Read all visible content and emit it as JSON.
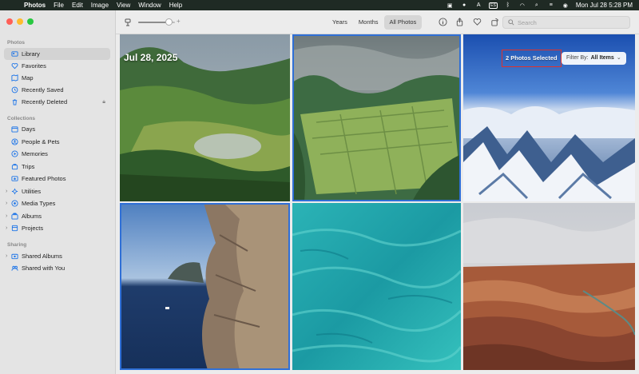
{
  "menubar": {
    "app_name": "Photos",
    "menus": [
      "File",
      "Edit",
      "Image",
      "View",
      "Window",
      "Help"
    ],
    "input_source": "ES",
    "datetime": "Mon Jul 28  5:28 PM"
  },
  "sidebar": {
    "sections": {
      "photos": "Photos",
      "collections": "Collections",
      "sharing": "Sharing"
    },
    "photos_items": [
      {
        "label": "Library",
        "icon": "library-icon",
        "selected": true
      },
      {
        "label": "Favorites",
        "icon": "heart-icon"
      },
      {
        "label": "Map",
        "icon": "map-icon"
      },
      {
        "label": "Recently Saved",
        "icon": "recently-saved-icon"
      },
      {
        "label": "Recently Deleted",
        "icon": "trash-icon",
        "locked": true
      }
    ],
    "collections_items": [
      {
        "label": "Days",
        "icon": "calendar-icon"
      },
      {
        "label": "People & Pets",
        "icon": "person-icon"
      },
      {
        "label": "Memories",
        "icon": "memories-icon"
      },
      {
        "label": "Trips",
        "icon": "suitcase-icon"
      },
      {
        "label": "Featured Photos",
        "icon": "featured-icon"
      },
      {
        "label": "Utilities",
        "icon": "utilities-icon",
        "expandable": true
      },
      {
        "label": "Media Types",
        "icon": "media-types-icon",
        "expandable": true
      },
      {
        "label": "Albums",
        "icon": "albums-icon",
        "expandable": true
      },
      {
        "label": "Projects",
        "icon": "projects-icon",
        "expandable": true
      }
    ],
    "sharing_items": [
      {
        "label": "Shared Albums",
        "icon": "shared-albums-icon",
        "expandable": true
      },
      {
        "label": "Shared with You",
        "icon": "shared-with-you-icon"
      }
    ]
  },
  "toolbar": {
    "views": [
      "Years",
      "Months",
      "All Photos"
    ],
    "active_view": "All Photos",
    "search_placeholder": "Search",
    "zoom_level": 0.8
  },
  "grid": {
    "date_heading": "Jul 28, 2025",
    "selected_count": "2 Photos Selected",
    "filter_label": "Filter By:",
    "filter_value": "All Items"
  },
  "colors": {
    "accent": "#1a73e8",
    "selection_outline": "#2f6fd6",
    "highlight_box": "#e0312b"
  }
}
